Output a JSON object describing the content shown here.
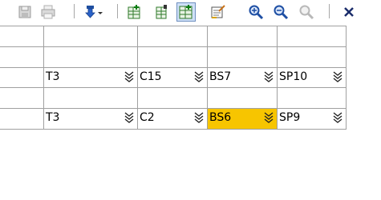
{
  "toolbar": {
    "buttons": [
      {
        "name": "save-icon",
        "tooltip": ""
      },
      {
        "name": "print-icon",
        "tooltip": ""
      },
      {
        "name": "move-down-dropdown-icon",
        "tooltip": ""
      },
      {
        "name": "add-row-icon",
        "tooltip": ""
      },
      {
        "name": "edit-row-icon",
        "tooltip": ""
      },
      {
        "name": "grid-options-icon",
        "tooltip": ""
      },
      {
        "name": "note-edit-icon",
        "tooltip": ""
      },
      {
        "name": "zoom-in-icon",
        "tooltip": ""
      },
      {
        "name": "zoom-out-icon",
        "tooltip": ""
      },
      {
        "name": "zoom-reset-icon",
        "tooltip": ""
      },
      {
        "name": "close-icon",
        "tooltip": ""
      }
    ]
  },
  "grid": {
    "rows": [
      [
        "",
        "",
        "",
        "",
        ""
      ],
      [
        "",
        "",
        "",
        "",
        ""
      ],
      [
        "",
        "T3",
        "C15",
        "BS7",
        "SP10"
      ],
      [
        "",
        "",
        "",
        "",
        ""
      ],
      [
        "",
        "T3",
        "C2",
        "BS6",
        "SP9"
      ]
    ],
    "highlighted_cell": {
      "row": 4,
      "col": 3
    },
    "highlight_color": "#f7c500"
  }
}
